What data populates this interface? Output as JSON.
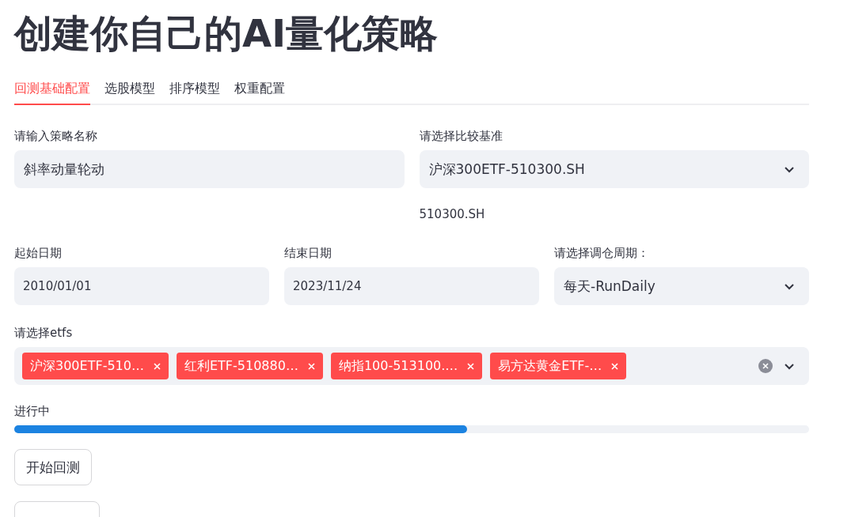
{
  "title": "创建你自己的AI量化策略",
  "tabs": [
    {
      "label": "回测基础配置",
      "selected": true
    },
    {
      "label": "选股模型",
      "selected": false
    },
    {
      "label": "排序模型",
      "selected": false
    },
    {
      "label": "权重配置",
      "selected": false
    }
  ],
  "row_1": [
    {
      "kind": "text",
      "label": "请输入策略名称",
      "value": "斜率动量轮动"
    },
    {
      "kind": "select",
      "label": "请选择比较基准",
      "value": "沪深300ETF-510300.SH",
      "caption": "510300.SH"
    }
  ],
  "row_2": [
    {
      "kind": "date",
      "label": "起始日期",
      "value": "2010/01/01"
    },
    {
      "kind": "date",
      "label": "结束日期",
      "value": "2023/11/24"
    },
    {
      "kind": "select",
      "label": "请选择调仓周期：",
      "value": "每天-RunDaily"
    }
  ],
  "etfs": {
    "label": "请选择etfs",
    "tags": [
      "沪深300ETF-510…",
      "红利ETF-510880…",
      "纳指100-513100.…",
      "易方达黄金ETF-…"
    ]
  },
  "progress": {
    "label": "进行中",
    "level": 0.57
  },
  "buttons": [
    "开始回测"
  ]
}
